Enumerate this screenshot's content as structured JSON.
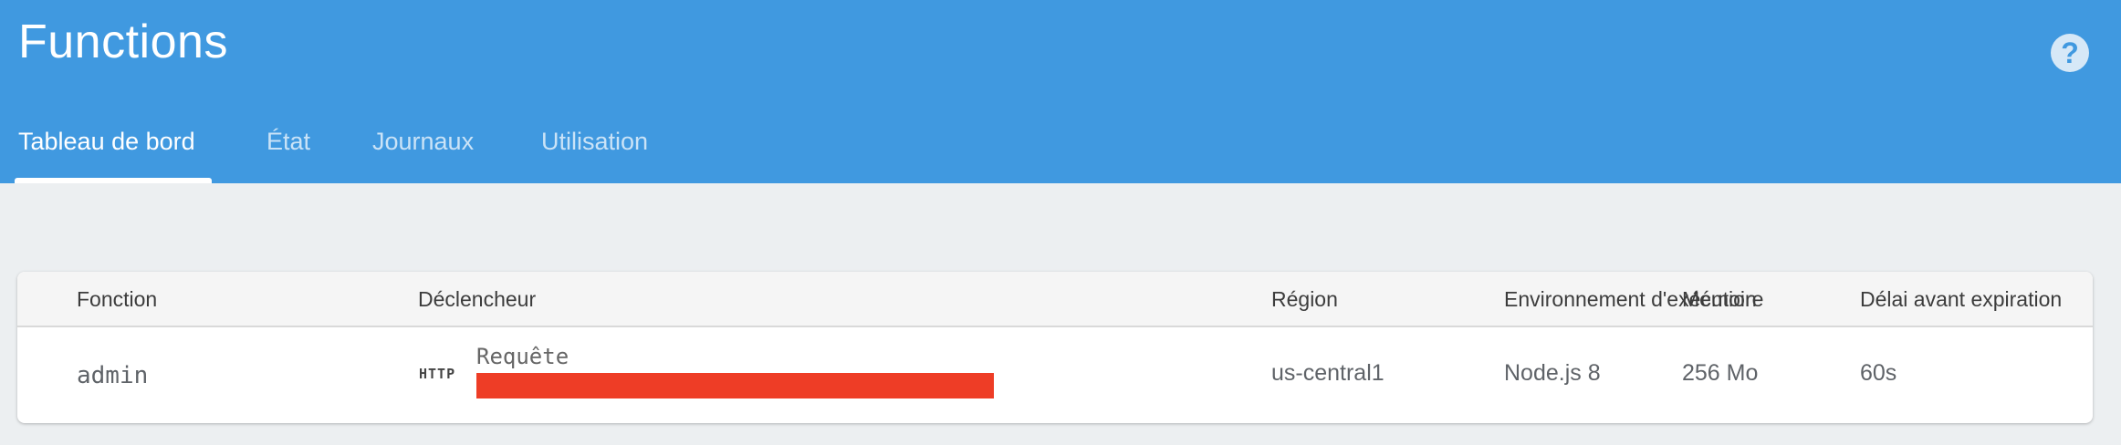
{
  "header": {
    "title": "Functions",
    "help_icon": "?",
    "tabs": [
      {
        "label": "Tableau de bord",
        "active": true
      },
      {
        "label": "État",
        "active": false
      },
      {
        "label": "Journaux",
        "active": false
      },
      {
        "label": "Utilisation",
        "active": false
      }
    ]
  },
  "table": {
    "columns": {
      "function": "Fonction",
      "trigger": "Déclencheur",
      "region": "Région",
      "environment": "Environnement d'exécution",
      "memory": "Mémoire",
      "timeout": "Délai avant expiration"
    },
    "rows": [
      {
        "function": "admin",
        "trigger_type": "HTTP",
        "trigger_label": "Requête",
        "trigger_url": "",
        "region": "us-central1",
        "environment": "Node.js 8",
        "memory": "256 Mo",
        "timeout": "60s"
      }
    ]
  },
  "colors": {
    "header_bg": "#4099e0",
    "page_bg": "#eceff1",
    "redaction": "#ee3d26"
  }
}
